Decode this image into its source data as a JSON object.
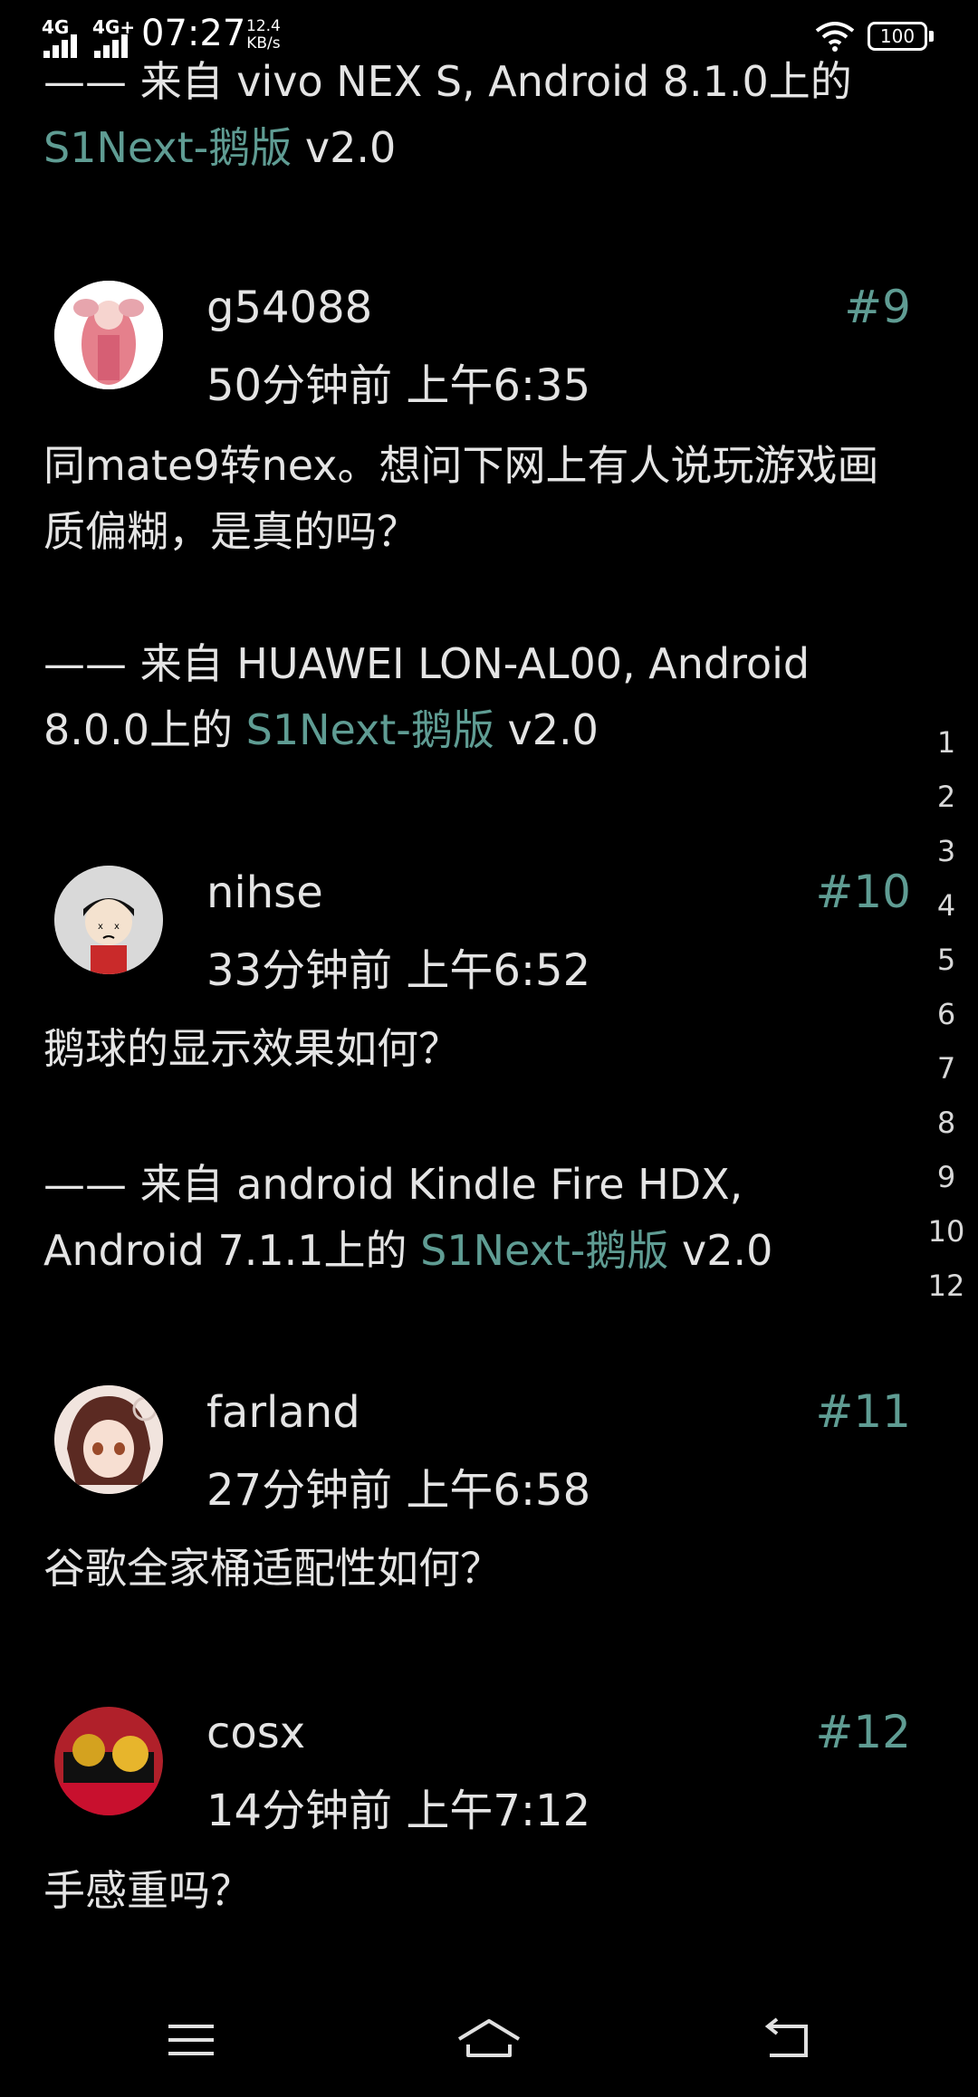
{
  "status": {
    "sim1": "4G",
    "sim2": "4G+",
    "time": "07:27",
    "speed_value": "12.4",
    "speed_unit": "KB/s",
    "battery": "100"
  },
  "top_post": {
    "signature_tail": "—— 来自 vivo NEX S, Android 8.1.0上的",
    "app_link": "S1Next-鹅版",
    "version": " v2.0"
  },
  "posts": [
    {
      "username": "g54088",
      "floor": "#9",
      "time": "50分钟前 上午6:35",
      "content": "同mate9转nex。想问下网上有人说玩游戏画质偏糊，是真的吗？",
      "signature": "—— 来自 HUAWEI LON-AL00, Android 8.0.0上的 ",
      "app_link": "S1Next-鹅版",
      "version": " v2.0"
    },
    {
      "username": "nihse",
      "floor": "#10",
      "time": "33分钟前 上午6:52",
      "content": "鹅球的显示效果如何？",
      "signature": "—— 来自 android Kindle Fire HDX, Android 7.1.1上的 ",
      "app_link": "S1Next-鹅版",
      "version": " v2.0"
    },
    {
      "username": "farland",
      "floor": "#11",
      "time": "27分钟前 上午6:58",
      "content": "谷歌全家桶适配性如何？"
    },
    {
      "username": "cosx",
      "floor": "#12",
      "time": "14分钟前 上午7:12",
      "content": "手感重吗？"
    }
  ],
  "page_index": [
    "1",
    "2",
    "3",
    "4",
    "5",
    "6",
    "7",
    "8",
    "9",
    "10",
    "12"
  ],
  "nav": {
    "menu_icon": "menu-icon",
    "home_icon": "home-icon",
    "back_icon": "back-icon"
  }
}
